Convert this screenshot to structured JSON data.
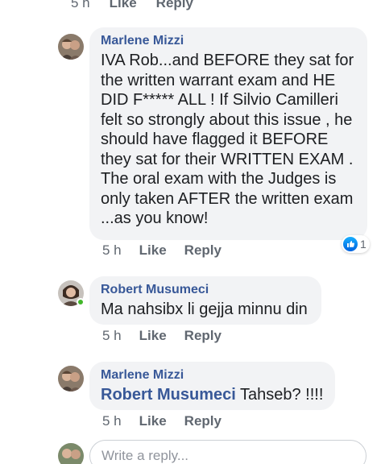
{
  "top": {
    "time": "5 h",
    "like": "Like",
    "reply": "Reply"
  },
  "comments": [
    {
      "author": "Marlene Mizzi",
      "text": "IVA Rob...and BEFORE they sat for the written warrant exam and HE DID F***** ALL !  If Silvio Camilleri felt so strongly about this issue , he should have flagged it BEFORE they sat for their WRITTEN EXAM . The oral exam with the Judges is only taken AFTER the written exam ...as you know!",
      "time": "5 h",
      "like": "Like",
      "reply": "Reply",
      "reaction": {
        "icon": "thumbs-up-icon",
        "count": "1"
      }
    },
    {
      "author": "Robert Musumeci",
      "text": "Ma nahsibx li gejja minnu din",
      "time": "5 h",
      "like": "Like",
      "reply": "Reply"
    },
    {
      "author": "Marlene Mizzi",
      "mention": "Robert Musumeci",
      "text": " Tahseb? !!!!",
      "time": "5 h",
      "like": "Like",
      "reply": "Reply"
    }
  ],
  "reply_box": {
    "placeholder": "Write a reply..."
  },
  "colors": {
    "link": "#385898",
    "meta": "#606770",
    "bubble": "#f2f3f5",
    "online": "#42b72a",
    "like_blue": "#0062df"
  }
}
